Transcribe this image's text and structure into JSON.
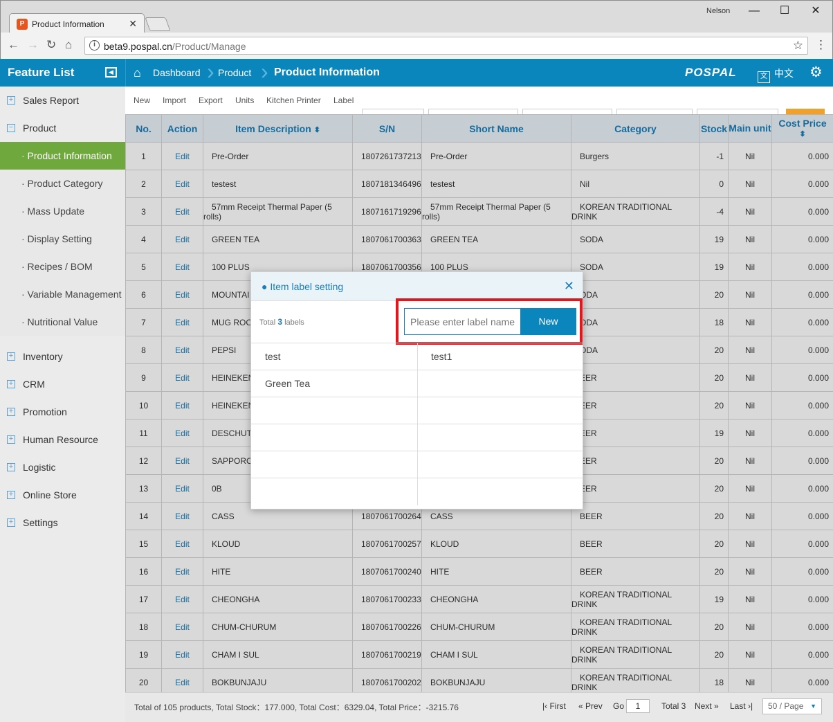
{
  "browser": {
    "tab_title": "Product Information",
    "tab_icon_glyph": "P",
    "user": "Nelson",
    "url_domain": "beta9.pospal.cn",
    "url_path": "/Product/Manage"
  },
  "header": {
    "feature_list": "Feature List",
    "crumbs": [
      "Dashboard",
      "Product",
      "Product Information"
    ],
    "logo": "POSPAL",
    "lang": "中文",
    "lang_icon_glyph": "文"
  },
  "sidebar": {
    "items": [
      {
        "label": "Sales Report",
        "type": "group",
        "expanded": false
      },
      {
        "label": "Product",
        "type": "group",
        "expanded": true
      },
      {
        "label": "· Product Information",
        "type": "sub",
        "active": true
      },
      {
        "label": "· Product Category",
        "type": "sub"
      },
      {
        "label": "· Mass Update",
        "type": "sub"
      },
      {
        "label": "· Display Setting",
        "type": "sub"
      },
      {
        "label": "· Recipes / BOM",
        "type": "sub"
      },
      {
        "label": "· Variable Management",
        "type": "sub"
      },
      {
        "label": "· Nutritional Value",
        "type": "sub"
      },
      {
        "label": "Inventory",
        "type": "group"
      },
      {
        "label": "CRM",
        "type": "group"
      },
      {
        "label": "Promotion",
        "type": "group"
      },
      {
        "label": "Human Resource",
        "type": "group"
      },
      {
        "label": "Logistic",
        "type": "group"
      },
      {
        "label": "Online Store",
        "type": "group"
      },
      {
        "label": "Settings",
        "type": "group"
      }
    ]
  },
  "toolbar": {
    "links": [
      "New",
      "Import",
      "Export",
      "Units",
      "Kitchen Printer",
      "Label"
    ]
  },
  "table": {
    "columns": [
      "No.",
      "Action",
      "Item Description",
      "S/N",
      "Short Name",
      "Category",
      "Stock",
      "Main unit",
      "Cost Price"
    ],
    "rows": [
      {
        "no": "1",
        "action": "Edit",
        "desc": "Pre-Order",
        "sn": "1807261737213",
        "short": "Pre-Order",
        "cat": "Burgers",
        "stock": "-1",
        "unit": "Nil",
        "cost": "0.000"
      },
      {
        "no": "2",
        "action": "Edit",
        "desc": "testest",
        "sn": "1807181346496",
        "short": "testest",
        "cat": "Nil",
        "stock": "0",
        "unit": "Nil",
        "cost": "0.000"
      },
      {
        "no": "3",
        "action": "Edit",
        "desc": "57mm Receipt Thermal Paper (5 rolls)",
        "sn": "1807161719296",
        "short": "57mm Receipt Thermal Paper (5 rolls)",
        "cat": "KOREAN TRADITIONAL DRINK",
        "stock": "-4",
        "unit": "Nil",
        "cost": "0.000"
      },
      {
        "no": "4",
        "action": "Edit",
        "desc": "GREEN TEA",
        "sn": "1807061700363",
        "short": "GREEN TEA",
        "cat": "SODA",
        "stock": "19",
        "unit": "Nil",
        "cost": "0.000"
      },
      {
        "no": "5",
        "action": "Edit",
        "desc": "100 PLUS",
        "sn": "1807061700356",
        "short": "100 PLUS",
        "cat": "SODA",
        "stock": "19",
        "unit": "Nil",
        "cost": "0.000"
      },
      {
        "no": "6",
        "action": "Edit",
        "desc": "MOUNTAI",
        "sn": "",
        "short": "",
        "cat": "ODA",
        "stock": "20",
        "unit": "Nil",
        "cost": "0.000"
      },
      {
        "no": "7",
        "action": "Edit",
        "desc": "MUG ROC",
        "sn": "",
        "short": "",
        "cat": "ODA",
        "stock": "18",
        "unit": "Nil",
        "cost": "0.000"
      },
      {
        "no": "8",
        "action": "Edit",
        "desc": "PEPSI",
        "sn": "",
        "short": "",
        "cat": "ODA",
        "stock": "20",
        "unit": "Nil",
        "cost": "0.000"
      },
      {
        "no": "9",
        "action": "Edit",
        "desc": "HEINEKEN",
        "sn": "",
        "short": "",
        "cat": "EER",
        "stock": "20",
        "unit": "Nil",
        "cost": "0.000"
      },
      {
        "no": "10",
        "action": "Edit",
        "desc": "HEINEKEN",
        "sn": "",
        "short": "",
        "cat": "EER",
        "stock": "20",
        "unit": "Nil",
        "cost": "0.000"
      },
      {
        "no": "11",
        "action": "Edit",
        "desc": "DESCHUT",
        "sn": "",
        "short": "",
        "cat": "EER",
        "stock": "19",
        "unit": "Nil",
        "cost": "0.000"
      },
      {
        "no": "12",
        "action": "Edit",
        "desc": "SAPPORO",
        "sn": "",
        "short": "",
        "cat": "EER",
        "stock": "20",
        "unit": "Nil",
        "cost": "0.000"
      },
      {
        "no": "13",
        "action": "Edit",
        "desc": "0B",
        "sn": "",
        "short": "",
        "cat": "EER",
        "stock": "20",
        "unit": "Nil",
        "cost": "0.000"
      },
      {
        "no": "14",
        "action": "Edit",
        "desc": "CASS",
        "sn": "1807061700264",
        "short": "CASS",
        "cat": "BEER",
        "stock": "20",
        "unit": "Nil",
        "cost": "0.000"
      },
      {
        "no": "15",
        "action": "Edit",
        "desc": "KLOUD",
        "sn": "1807061700257",
        "short": "KLOUD",
        "cat": "BEER",
        "stock": "20",
        "unit": "Nil",
        "cost": "0.000"
      },
      {
        "no": "16",
        "action": "Edit",
        "desc": "HITE",
        "sn": "1807061700240",
        "short": "HITE",
        "cat": "BEER",
        "stock": "20",
        "unit": "Nil",
        "cost": "0.000"
      },
      {
        "no": "17",
        "action": "Edit",
        "desc": "CHEONGHA",
        "sn": "1807061700233",
        "short": "CHEONGHA",
        "cat": "KOREAN TRADITIONAL DRINK",
        "stock": "19",
        "unit": "Nil",
        "cost": "0.000"
      },
      {
        "no": "18",
        "action": "Edit",
        "desc": "CHUM-CHURUM",
        "sn": "1807061700226",
        "short": "CHUM-CHURUM",
        "cat": "KOREAN TRADITIONAL DRINK",
        "stock": "20",
        "unit": "Nil",
        "cost": "0.000"
      },
      {
        "no": "19",
        "action": "Edit",
        "desc": "CHAM I SUL",
        "sn": "1807061700219",
        "short": "CHAM I SUL",
        "cat": "KOREAN TRADITIONAL DRINK",
        "stock": "20",
        "unit": "Nil",
        "cost": "0.000"
      },
      {
        "no": "20",
        "action": "Edit",
        "desc": "BOKBUNJAJU",
        "sn": "1807061700202",
        "short": "BOKBUNJAJU",
        "cat": "KOREAN TRADITIONAL DRINK",
        "stock": "18",
        "unit": "Nil",
        "cost": "0.000"
      }
    ]
  },
  "footer": {
    "summary": "Total of 105 products, Total Stock：177.000, Total Cost：6329.04, Total Price：-3215.76",
    "first": "First",
    "prev": "Prev",
    "go": "Go",
    "page": "1",
    "total": "Total 3",
    "next": "Next",
    "last": "Last",
    "page_size": "50 / Page"
  },
  "modal": {
    "title": "● Item label setting",
    "total_prefix": "Total",
    "total_count": "3",
    "total_suffix": "labels",
    "input_placeholder": "Please enter label name",
    "new_button": "New",
    "labels": [
      [
        "test",
        "test1"
      ],
      [
        "Green Tea",
        ""
      ],
      [
        "",
        ""
      ],
      [
        "",
        ""
      ],
      [
        "",
        ""
      ],
      [
        "",
        ""
      ]
    ]
  }
}
